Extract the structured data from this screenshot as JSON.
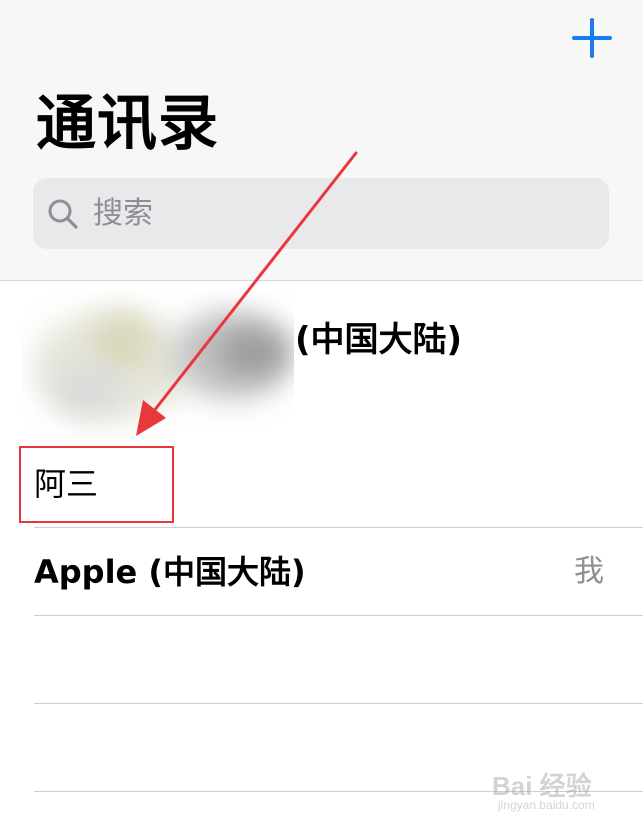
{
  "header": {
    "add_icon": "plus-icon",
    "title": "通讯录",
    "accent_color": "#1a7cf5"
  },
  "search": {
    "icon": "magnifier-icon",
    "placeholder": "搜索"
  },
  "my_card": {
    "subtitle": "(中国大陆)"
  },
  "contacts": [
    {
      "name": "阿三"
    },
    {
      "name": "Apple (中国大陆)",
      "badge": "我"
    }
  ],
  "annotation": {
    "color": "#e8383d"
  },
  "watermark": {
    "main": "Bai 经验",
    "sub": "jingyan.baidu.com"
  }
}
